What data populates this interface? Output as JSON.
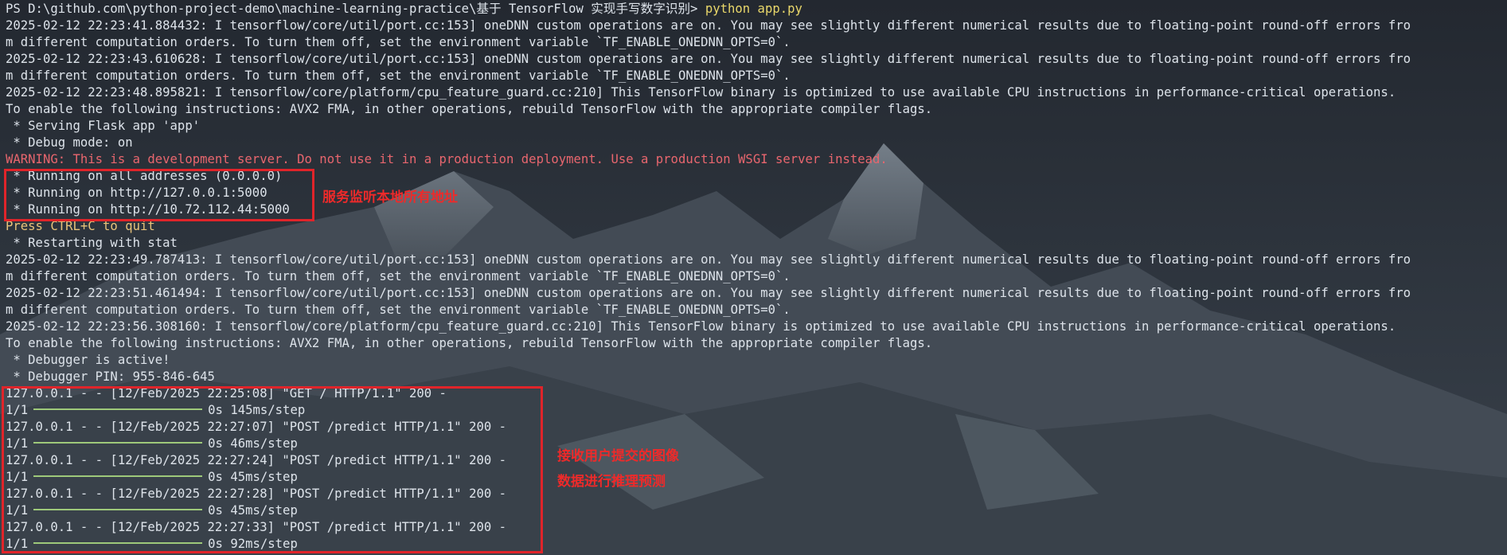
{
  "terminal": {
    "prompt": "PS D:\\github.com\\python-project-demo\\machine-learning-practice\\基于 TensorFlow 实现手写数字识别>",
    "command": "python app.py",
    "lines": [
      "2025-02-12 22:23:41.884432: I tensorflow/core/util/port.cc:153] oneDNN custom operations are on. You may see slightly different numerical results due to floating-point round-off errors fro",
      "m different computation orders. To turn them off, set the environment variable `TF_ENABLE_ONEDNN_OPTS=0`.",
      "2025-02-12 22:23:43.610628: I tensorflow/core/util/port.cc:153] oneDNN custom operations are on. You may see slightly different numerical results due to floating-point round-off errors fro",
      "m different computation orders. To turn them off, set the environment variable `TF_ENABLE_ONEDNN_OPTS=0`.",
      "2025-02-12 22:23:48.895821: I tensorflow/core/platform/cpu_feature_guard.cc:210] This TensorFlow binary is optimized to use available CPU instructions in performance-critical operations.",
      "To enable the following instructions: AVX2 FMA, in other operations, rebuild TensorFlow with the appropriate compiler flags.",
      " * Serving Flask app 'app'",
      " * Debug mode: on",
      "WARNING: This is a development server. Do not use it in a production deployment. Use a production WSGI server instead.",
      " * Running on all addresses (0.0.0.0)",
      " * Running on http://127.0.0.1:5000",
      " * Running on http://10.72.112.44:5000",
      "Press CTRL+C to quit",
      " * Restarting with stat",
      "2025-02-12 22:23:49.787413: I tensorflow/core/util/port.cc:153] oneDNN custom operations are on. You may see slightly different numerical results due to floating-point round-off errors fro",
      "m different computation orders. To turn them off, set the environment variable `TF_ENABLE_ONEDNN_OPTS=0`.",
      "2025-02-12 22:23:51.461494: I tensorflow/core/util/port.cc:153] oneDNN custom operations are on. You may see slightly different numerical results due to floating-point round-off errors fro",
      "m different computation orders. To turn them off, set the environment variable `TF_ENABLE_ONEDNN_OPTS=0`.",
      "2025-02-12 22:23:56.308160: I tensorflow/core/platform/cpu_feature_guard.cc:210] This TensorFlow binary is optimized to use available CPU instructions in performance-critical operations.",
      "To enable the following instructions: AVX2 FMA, in other operations, rebuild TensorFlow with the appropriate compiler flags.",
      " * Debugger is active!",
      " * Debugger PIN: 955-846-645",
      "127.0.0.1 - - [12/Feb/2025 22:25:08] \"GET / HTTP/1.1\" 200 -"
    ],
    "requests": [
      {
        "timing": "0s 145ms/step"
      },
      {
        "log": "127.0.0.1 - - [12/Feb/2025 22:27:07] \"POST /predict HTTP/1.1\" 200 -",
        "timing": "0s 46ms/step"
      },
      {
        "log": "127.0.0.1 - - [12/Feb/2025 22:27:24] \"POST /predict HTTP/1.1\" 200 -",
        "timing": "0s 45ms/step"
      },
      {
        "log": "127.0.0.1 - - [12/Feb/2025 22:27:28] \"POST /predict HTTP/1.1\" 200 -",
        "timing": "0s 45ms/step"
      },
      {
        "log": "127.0.0.1 - - [12/Feb/2025 22:27:33] \"POST /predict HTTP/1.1\" 200 -",
        "timing": "0s 92ms/step"
      }
    ],
    "step_prefix": "1/1"
  },
  "annotations": {
    "listen_note": "服务监听本地所有地址",
    "request_note_line1": "接收用户提交的图像",
    "request_note_line2": "数据进行推理预测"
  },
  "colors": {
    "background": "#2a3038",
    "text": "#dde3ea",
    "command": "#e9d76a",
    "warning": "#e8666e",
    "quit": "#e8c37a",
    "progress_bar": "#9ec97a",
    "annotation_red": "#e0242a"
  }
}
